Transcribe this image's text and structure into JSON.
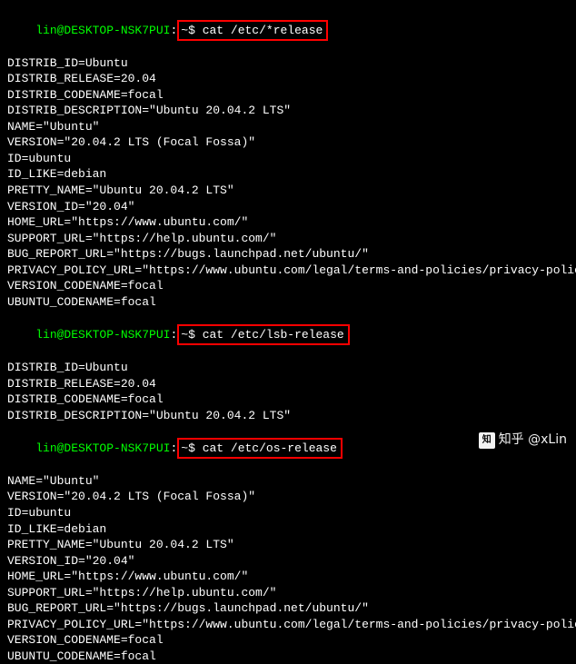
{
  "prompt": {
    "user_host": "lin@DESKTOP-NSK7PUI",
    "colon": ":",
    "path_symbol": "~",
    "sep": "$ "
  },
  "commands": {
    "cmd1": "cat /etc/*release",
    "cmd2": "cat /etc/lsb-release",
    "cmd3": "cat /etc/os-release"
  },
  "block1": [
    "DISTRIB_ID=Ubuntu",
    "DISTRIB_RELEASE=20.04",
    "DISTRIB_CODENAME=focal",
    "DISTRIB_DESCRIPTION=\"Ubuntu 20.04.2 LTS\"",
    "NAME=\"Ubuntu\"",
    "VERSION=\"20.04.2 LTS (Focal Fossa)\"",
    "ID=ubuntu",
    "ID_LIKE=debian",
    "PRETTY_NAME=\"Ubuntu 20.04.2 LTS\"",
    "VERSION_ID=\"20.04\"",
    "HOME_URL=\"https://www.ubuntu.com/\"",
    "SUPPORT_URL=\"https://help.ubuntu.com/\"",
    "BUG_REPORT_URL=\"https://bugs.launchpad.net/ubuntu/\"",
    "PRIVACY_POLICY_URL=\"https://www.ubuntu.com/legal/terms-and-policies/privacy-policy\"",
    "VERSION_CODENAME=focal",
    "UBUNTU_CODENAME=focal"
  ],
  "block2": [
    "DISTRIB_ID=Ubuntu",
    "DISTRIB_RELEASE=20.04",
    "DISTRIB_CODENAME=focal",
    "DISTRIB_DESCRIPTION=\"Ubuntu 20.04.2 LTS\""
  ],
  "block3": [
    "NAME=\"Ubuntu\"",
    "VERSION=\"20.04.2 LTS (Focal Fossa)\"",
    "ID=ubuntu",
    "ID_LIKE=debian",
    "PRETTY_NAME=\"Ubuntu 20.04.2 LTS\"",
    "VERSION_ID=\"20.04\"",
    "HOME_URL=\"https://www.ubuntu.com/\"",
    "SUPPORT_URL=\"https://help.ubuntu.com/\"",
    "BUG_REPORT_URL=\"https://bugs.launchpad.net/ubuntu/\"",
    "PRIVACY_POLICY_URL=\"https://www.ubuntu.com/legal/terms-and-policies/privacy-policy\"",
    "VERSION_CODENAME=focal",
    "UBUNTU_CODENAME=focal"
  ],
  "watermark": {
    "icon_text": "知",
    "text": "知乎 @xLin"
  }
}
